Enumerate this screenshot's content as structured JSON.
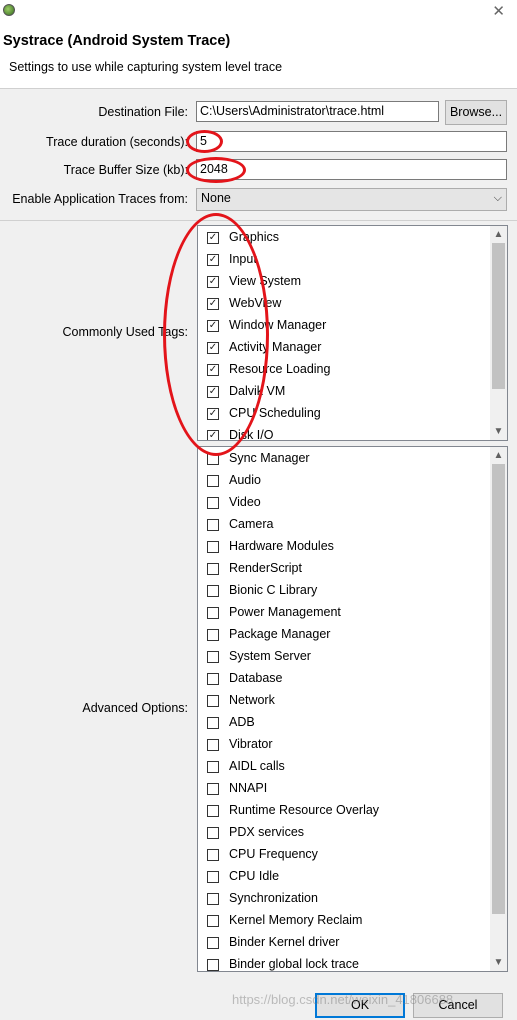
{
  "window": {
    "icon": "android-leaf-icon",
    "close_glyph": "✕"
  },
  "header": {
    "title": "Systrace (Android System Trace)",
    "subtitle": "Settings to use while capturing system level trace"
  },
  "form": {
    "destination_label": "Destination File:",
    "destination_value": "C:\\Users\\Administrator\\trace.html",
    "browse_label": "Browse...",
    "duration_label": "Trace duration (seconds):",
    "duration_value": "5",
    "buffer_label": "Trace Buffer Size (kb):",
    "buffer_value": "2048",
    "app_traces_label": "Enable Application Traces from:",
    "app_traces_value": "None"
  },
  "common_tags": {
    "label": "Commonly Used Tags:",
    "items": [
      {
        "label": "Graphics",
        "checked": true
      },
      {
        "label": "Input",
        "checked": true
      },
      {
        "label": "View System",
        "checked": true
      },
      {
        "label": "WebView",
        "checked": true
      },
      {
        "label": "Window Manager",
        "checked": true
      },
      {
        "label": "Activity Manager",
        "checked": true
      },
      {
        "label": "Resource Loading",
        "checked": true
      },
      {
        "label": "Dalvik VM",
        "checked": true
      },
      {
        "label": "CPU Scheduling",
        "checked": true
      },
      {
        "label": "Disk I/O",
        "checked": true
      }
    ]
  },
  "advanced": {
    "label": "Advanced Options:",
    "items": [
      {
        "label": "Sync Manager",
        "checked": false
      },
      {
        "label": "Audio",
        "checked": false
      },
      {
        "label": "Video",
        "checked": false
      },
      {
        "label": "Camera",
        "checked": false
      },
      {
        "label": "Hardware Modules",
        "checked": false
      },
      {
        "label": "RenderScript",
        "checked": false
      },
      {
        "label": "Bionic C Library",
        "checked": false
      },
      {
        "label": "Power Management",
        "checked": false
      },
      {
        "label": "Package Manager",
        "checked": false
      },
      {
        "label": "System Server",
        "checked": false
      },
      {
        "label": "Database",
        "checked": false
      },
      {
        "label": "Network",
        "checked": false
      },
      {
        "label": "ADB",
        "checked": false
      },
      {
        "label": "Vibrator",
        "checked": false
      },
      {
        "label": "AIDL calls",
        "checked": false
      },
      {
        "label": "NNAPI",
        "checked": false
      },
      {
        "label": "Runtime Resource Overlay",
        "checked": false
      },
      {
        "label": "PDX services",
        "checked": false
      },
      {
        "label": "CPU Frequency",
        "checked": false
      },
      {
        "label": "CPU Idle",
        "checked": false
      },
      {
        "label": "Synchronization",
        "checked": false
      },
      {
        "label": "Kernel Memory Reclaim",
        "checked": false
      },
      {
        "label": "Binder Kernel driver",
        "checked": false
      },
      {
        "label": "Binder global lock trace",
        "checked": false
      }
    ]
  },
  "footer": {
    "ok_label": "OK",
    "cancel_label": "Cancel",
    "watermark": "https://blog.csdn.net/weixin_41806688"
  },
  "icons": {
    "scroll_up": "chevron-up-icon",
    "scroll_down": "chevron-down-icon",
    "dropdown": "chevron-down-icon"
  },
  "colors": {
    "annotation": "#e3141a",
    "accent_border": "#0078d7"
  }
}
